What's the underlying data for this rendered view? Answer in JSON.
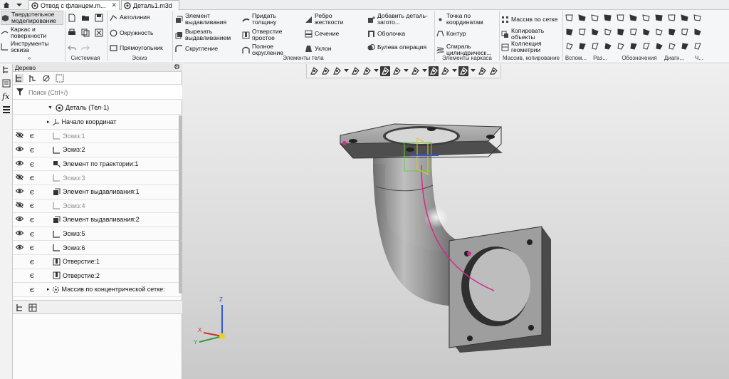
{
  "tabs": [
    {
      "label": "Отвод с фланцем.m...",
      "active": true
    },
    {
      "label": "Деталь1.m3d",
      "active": false
    }
  ],
  "ribbon": {
    "mode_items": [
      "Твердотельное моделирование",
      "Каркас и поверхности",
      "Инструменты эскиза"
    ],
    "system_label": "Системная",
    "sketch": {
      "items": [
        "Автолиния",
        "Окружность",
        "Прямоугольник"
      ],
      "label": "Эскиз"
    },
    "body": {
      "col1": [
        "Элемент выдавливания",
        "Вырезать выдавливанием",
        "Скругление"
      ],
      "col2": [
        "Придать толщину",
        "Отверстие простое",
        "Полное скругление"
      ],
      "col3": [
        "Ребро жесткости",
        "Сечение",
        "Уклон"
      ],
      "col4": [
        "Добавить деталь-загото...",
        "Оболочка",
        "Булева операция"
      ],
      "label": "Элементы тела"
    },
    "frame": {
      "items": [
        "Точка по координатам",
        "Контур",
        "Спираль цилиндрическ..."
      ],
      "label": "Элементы каркаса"
    },
    "array": {
      "items": [
        "Массив по сетке",
        "Копировать объекты",
        "Коллекция геометрии"
      ],
      "label": "Массив, копирование"
    },
    "small_groups": [
      "Вспом...",
      "Раз...",
      "Обозначения",
      "Диагн...",
      "Ч..."
    ]
  },
  "tree": {
    "title": "Дерево",
    "search_placeholder": "Поиск (Ctrl+/)",
    "root": "Деталь (Тел-1)",
    "rows": [
      {
        "label": "Начало координат",
        "eye": "",
        "ep": "",
        "style": "normal",
        "expand": true
      },
      {
        "label": "Эскиз:1",
        "eye": "hidden",
        "ep": "yes",
        "style": "gray",
        "expand": false
      },
      {
        "label": "Эскиз:2",
        "eye": "visible",
        "ep": "yes",
        "style": "normal",
        "expand": false
      },
      {
        "label": "Элемент по траектории:1",
        "eye": "visible",
        "ep": "yes",
        "style": "normal",
        "expand": false
      },
      {
        "label": "Эскиз:3",
        "eye": "hidden",
        "ep": "yes",
        "style": "gray",
        "expand": false
      },
      {
        "label": "Элемент выдавливания:1",
        "eye": "visible",
        "ep": "yes",
        "style": "normal",
        "expand": false
      },
      {
        "label": "Эскиз:4",
        "eye": "hidden",
        "ep": "yes",
        "style": "gray",
        "expand": false
      },
      {
        "label": "Элемент выдавливания:2",
        "eye": "visible",
        "ep": "yes",
        "style": "normal",
        "expand": false
      },
      {
        "label": "Эскиз:5",
        "eye": "visible",
        "ep": "yes",
        "style": "normal",
        "expand": false
      },
      {
        "label": "Эскиз:6",
        "eye": "visible",
        "ep": "yes",
        "style": "normal",
        "expand": false
      },
      {
        "label": "Отверстие:1",
        "eye": "",
        "ep": "yes",
        "style": "normal",
        "expand": false
      },
      {
        "label": "Отверстие:2",
        "eye": "",
        "ep": "yes",
        "style": "normal",
        "expand": false
      },
      {
        "label": "Массив по концентрической сетке:",
        "eye": "",
        "ep": "yes",
        "style": "normal",
        "expand": true
      }
    ]
  },
  "axes": {
    "x": "X",
    "y": "Y",
    "z": "Z"
  },
  "colors": {
    "accent": "#d62a8a",
    "sketch_green": "#5fcf3a",
    "sketch_yellow": "#e8c81a",
    "axis_x": "#d0302c",
    "axis_y": "#2ea043",
    "axis_z": "#2f59d8"
  }
}
